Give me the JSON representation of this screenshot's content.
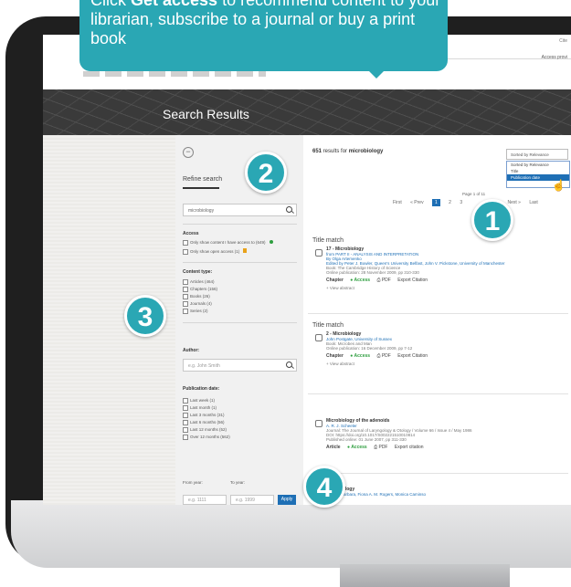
{
  "callout": {
    "lead": "Click ",
    "bold": "Get access",
    "rest": " to recommend content to your librarian, subscribe to a journal or buy a print book"
  },
  "nav": {
    "links": "Cite",
    "access_point": "Access provi"
  },
  "banner": {
    "title": "Search Results"
  },
  "badges": [
    "1",
    "2",
    "3",
    "4"
  ],
  "sidebar": {
    "collapse_glyph": "−",
    "refine_title": "Refine search",
    "search_value": "microbiology",
    "access": {
      "title": "Access",
      "options": [
        "Only show content I have access to (649)",
        "Only show open access (1)"
      ]
    },
    "content_type": {
      "title": "Content type:",
      "options": [
        "Articles (464)",
        "Chapters (156)",
        "Books (26)",
        "Journals (4)",
        "Series (2)"
      ]
    },
    "author": {
      "title": "Author:",
      "placeholder": "e.g. John Smith"
    },
    "publication_date": {
      "title": "Publication date:",
      "options": [
        "Last week (1)",
        "Last month (1)",
        "Last 3 months (31)",
        "Last 6 months (56)",
        "Last 12 months (52)",
        "Over 12 months (562)"
      ],
      "from_label": "From year:",
      "to_label": "To year:",
      "from_placeholder": "e.g. 1111",
      "to_placeholder": "e.g. 1999",
      "go_label": "Apply"
    }
  },
  "results": {
    "count_number": "651",
    "count_text": " results for ",
    "query": "microbiology",
    "sort_label": "Sorted by Relevance",
    "sort_options": [
      "Sorted by Relevance",
      "Title",
      "Publication date"
    ],
    "page_of": "Page 1 of 11",
    "pager": [
      "First",
      "« Prev",
      "1",
      "2",
      "3",
      "Next »",
      "Last"
    ],
    "items": [
      {
        "match": "Title match",
        "title": "17 - Microbiology",
        "line1": "from PART II - ANALYSIS AND INTERPRETATION",
        "line2": "By Olga Artemenko",
        "line3": "Edited by Peter J. Bowler, Queen's University Belfast, John V. Pickstone, University of Manchester",
        "meta1": "Book: The Cambridge History of Science",
        "meta2": "Online publication: 28 November 2009, pp 310-330",
        "type": "Chapter",
        "access": "Access",
        "pdf": "PDF",
        "export": "Export Citation",
        "view": "View abstract"
      },
      {
        "match": "Title match",
        "title": "2 - Microbiology",
        "line1": "John Postgate, University of Sussex",
        "meta1": "Book: Microbes and Man",
        "meta2": "Online publication: 16 December 2009, pp 7-12",
        "type": "Chapter",
        "access": "Access",
        "pdf": "PDF",
        "export": "Export Citation",
        "view": "View abstract"
      },
      {
        "match": "",
        "title": "Microbiology of the adenoids",
        "line1": "A. R. J. Scheeler",
        "meta1": "Journal: The Journal of Laryngology & Otology / Volume 66 / Issue 4 / May 1986",
        "meta2": "DOI: https://doi.org/10.1017/S002221510010814",
        "meta3": "Published online: 01 June 2007, pp 311-330",
        "type": "Article",
        "access": "Access",
        "pdf": "PDF",
        "export": "Export citation"
      },
      {
        "match": "",
        "title": "Microbiology",
        "line1": "A. R. J. Barbara, Fiona A. M. Rogers, Monica Caminso"
      }
    ]
  }
}
